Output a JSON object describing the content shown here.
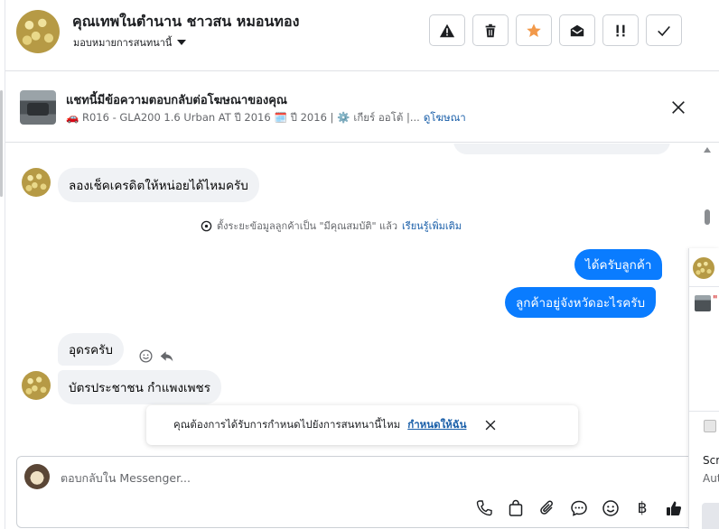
{
  "header": {
    "contact_name": "คุณเทพในตำนาน ชาวสน หมอนทอง",
    "assign_label": "มอบหมายการสนทนานี้",
    "actions": [
      "report-spam",
      "delete",
      "star",
      "mark-unread",
      "important",
      "mark-done"
    ]
  },
  "ad": {
    "title": "แชทนี้มีข้อความตอบกลับต่อโฆษณาของคุณ",
    "desc_model": "🚗 R016 - GLA200 1.6 Urban AT ปี 2016",
    "desc_year": "🗓️ ปี 2016 |",
    "desc_gear": "⚙️ เกียร์ ออโต้ |...",
    "view_ad": "ดูโฆษณา"
  },
  "messages": {
    "in1": "ลองเช็คเครดิตให้หน่อยได้ไหมครับ",
    "system_text": "ตั้งระยะข้อมูลลูกค้าเป็น \"มีคุณสมบัติ\" แล้ว",
    "system_link": "เรียนรู้เพิ่มเติม",
    "out1": "ได้ครับลูกค้า",
    "out2": "ลูกค้าอยู่จังหวัดอะไรครับ",
    "in2": "อุดรครับ",
    "in3": "บัตรประชาชน กำแพงเพชร"
  },
  "toast": {
    "text": "คุณต้องการได้รับการกำหนดไปยังการสนทนานี้ไหม",
    "action": "กำหนดให้ฉัน"
  },
  "composer": {
    "placeholder": "ตอบกลับใน Messenger...",
    "tools": [
      "phone-icon",
      "bag-icon",
      "paperclip-icon",
      "chat-bubble-icon",
      "emoji-icon",
      "baht-icon",
      "thumbs-up-icon"
    ],
    "baht_symbol": "฿"
  },
  "side_panel": {
    "fragment": "\"",
    "line1": "Scr",
    "line2": "Aut"
  },
  "colors": {
    "accent": "#0a7cff",
    "star": "#f2994a",
    "link": "#1a5fa9"
  }
}
